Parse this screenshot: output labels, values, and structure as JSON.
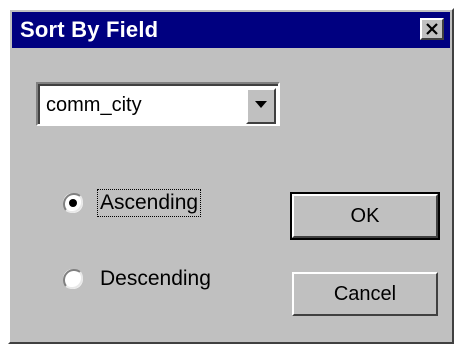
{
  "dialog": {
    "title": "Sort By Field",
    "close_icon": "close-icon"
  },
  "field_select": {
    "value": "comm_city",
    "arrow_icon": "chevron-down-icon"
  },
  "sort_order": {
    "options": [
      {
        "label": "Ascending",
        "selected": true
      },
      {
        "label": "Descending",
        "selected": false
      }
    ]
  },
  "buttons": {
    "ok_label": "OK",
    "cancel_label": "Cancel"
  },
  "colors": {
    "titlebar": "#000080",
    "face": "#c0c0c0"
  }
}
